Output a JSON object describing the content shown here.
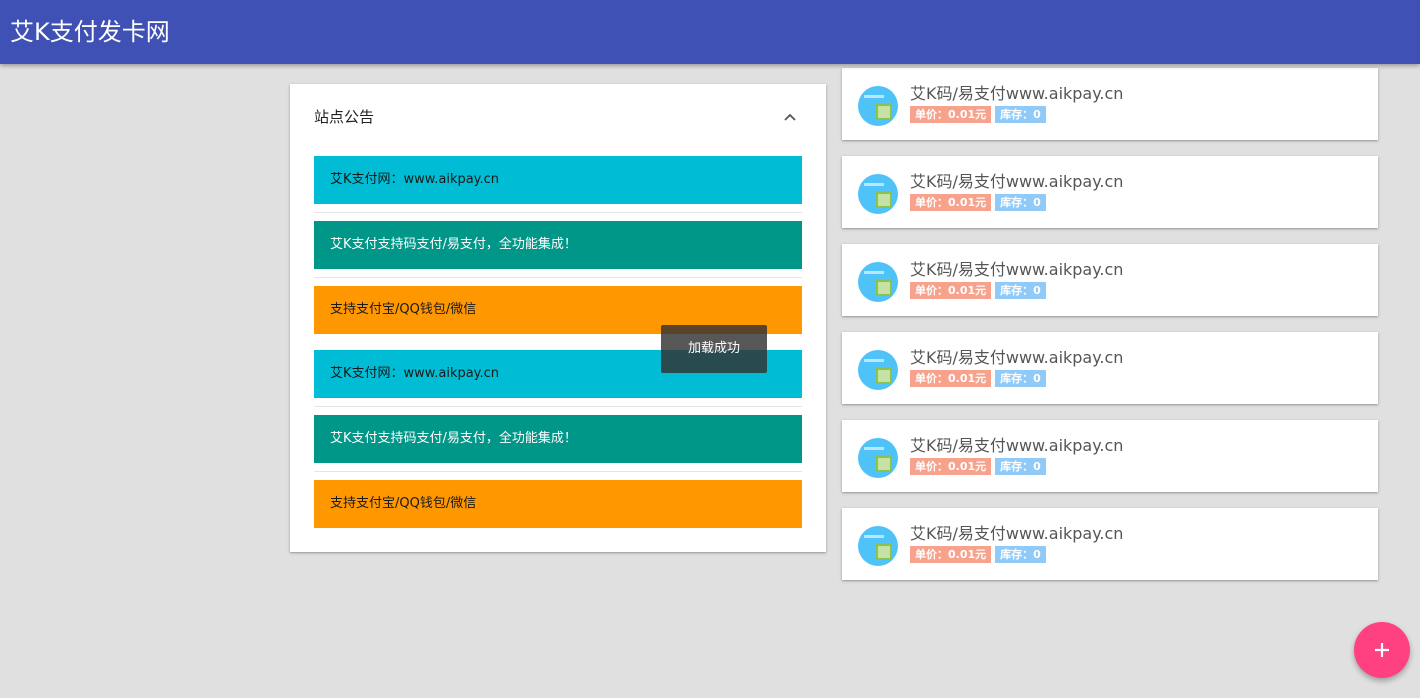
{
  "appbar": {
    "title": "艾K支付发卡网"
  },
  "notice": {
    "title": "站点公告",
    "items": [
      {
        "text": "艾K支付网：www.aikpay.cn",
        "color": "#00bcd4"
      },
      {
        "text": "艾K支付支持码支付/易支付，全功能集成！",
        "color": "#009688"
      },
      {
        "text": "支持支付宝/QQ钱包/微信",
        "color": "#ff9800"
      },
      {
        "text": "艾K支付网：www.aikpay.cn",
        "color": "#00bcd4"
      },
      {
        "text": "艾K支付支持码支付/易支付，全功能集成！",
        "color": "#009688"
      },
      {
        "text": "支持支付宝/QQ钱包/微信",
        "color": "#ff9800"
      }
    ]
  },
  "toast": {
    "text": "加载成功"
  },
  "products": [
    {
      "name": "艾K码/易支付www.aikpay.cn",
      "price": "单价：0.01元",
      "stock": "库存：0"
    },
    {
      "name": "艾K码/易支付www.aikpay.cn",
      "price": "单价：0.01元",
      "stock": "库存：0"
    },
    {
      "name": "艾K码/易支付www.aikpay.cn",
      "price": "单价：0.01元",
      "stock": "库存：0"
    },
    {
      "name": "艾K码/易支付www.aikpay.cn",
      "price": "单价：0.01元",
      "stock": "库存：0"
    },
    {
      "name": "艾K码/易支付www.aikpay.cn",
      "price": "单价：0.01元",
      "stock": "库存：0"
    },
    {
      "name": "艾K码/易支付www.aikpay.cn",
      "price": "单价：0.01元",
      "stock": "库存：0"
    }
  ],
  "icons": {
    "collapse": "chevron-up-icon",
    "fab": "plus-icon",
    "thumb": "product-image-icon"
  },
  "colors": {
    "appbar": "#3f51b5",
    "fab": "#ff4081",
    "price_badge": "#f6a28c",
    "stock_badge": "#90caf9"
  }
}
